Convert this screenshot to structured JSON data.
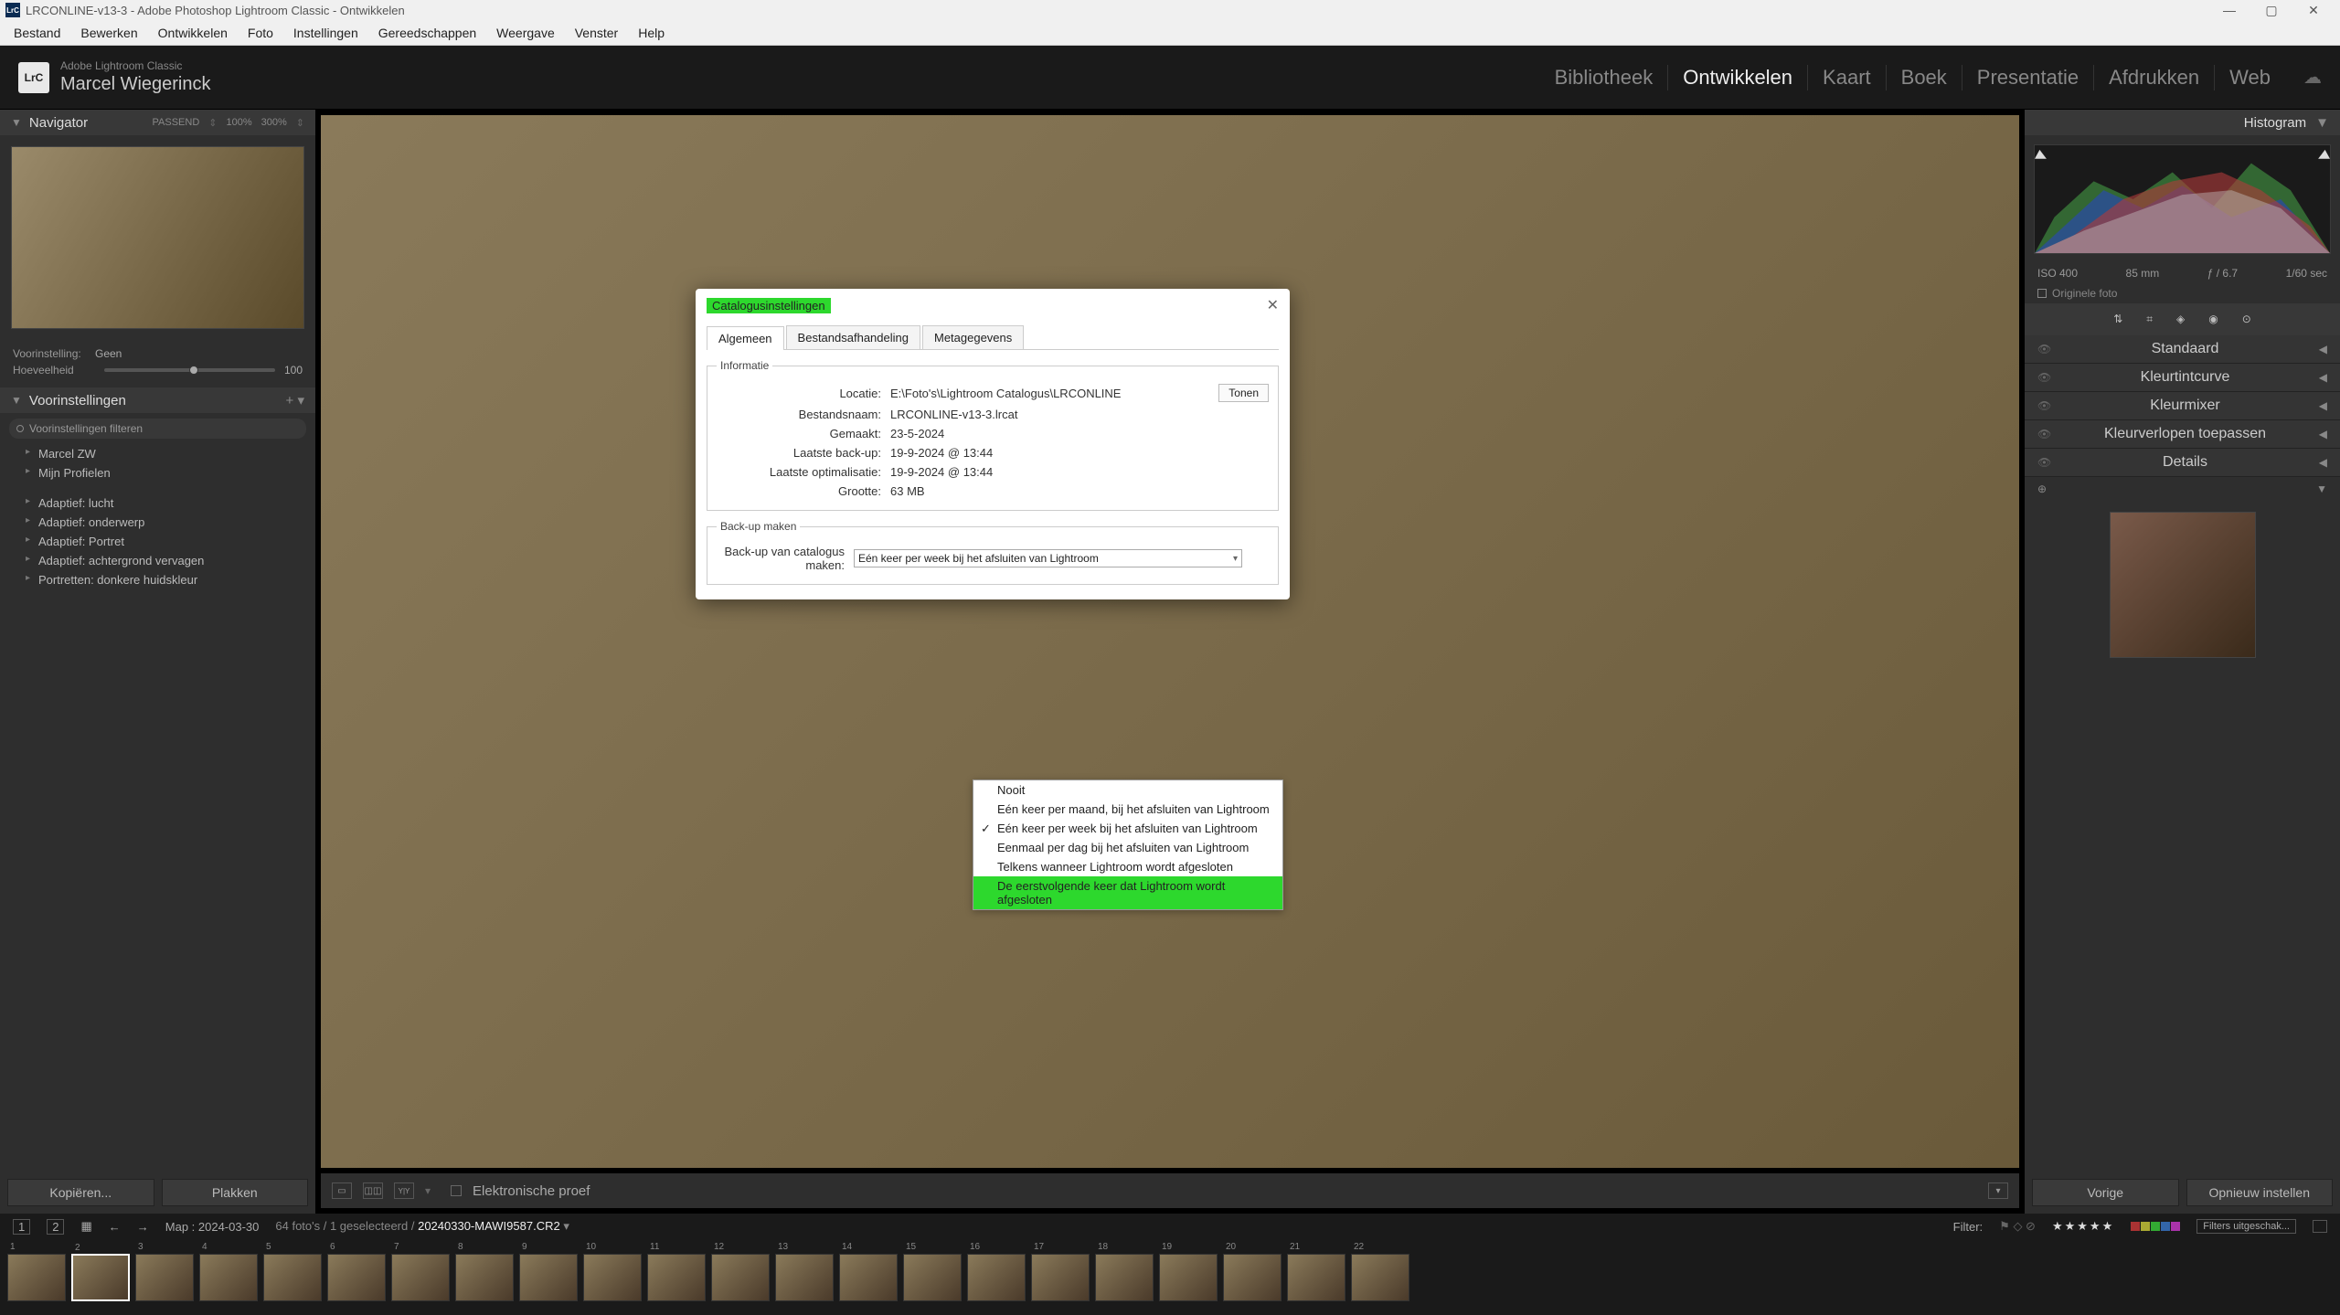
{
  "title_bar": "LRCONLINE-v13-3 - Adobe Photoshop Lightroom Classic - Ontwikkelen",
  "menu": [
    "Bestand",
    "Bewerken",
    "Ontwikkelen",
    "Foto",
    "Instellingen",
    "Gereedschappen",
    "Weergave",
    "Venster",
    "Help"
  ],
  "brand": {
    "icon": "LrC",
    "line1": "Adobe Lightroom Classic",
    "line2": "Marcel Wiegerinck"
  },
  "modules": [
    "Bibliotheek",
    "Ontwikkelen",
    "Kaart",
    "Boek",
    "Presentatie",
    "Afdrukken",
    "Web"
  ],
  "active_module": "Ontwikkelen",
  "navigator": {
    "title": "Navigator",
    "fit": "PASSEND",
    "zoom1": "100%",
    "zoom2": "300%"
  },
  "preset_ctrl": {
    "lbl1": "Voorinstelling:",
    "val1": "Geen",
    "lbl2": "Hoeveelheid",
    "val2": "100"
  },
  "presets_header": "Voorinstellingen",
  "filter_placeholder": "Voorinstellingen filteren",
  "preset_groups1": [
    "Marcel ZW",
    "Mijn Profielen"
  ],
  "preset_groups2": [
    "Adaptief: lucht",
    "Adaptief: onderwerp",
    "Adaptief: Portret",
    "Adaptief: achtergrond vervagen",
    "Portretten: donkere huidskleur"
  ],
  "buttons": {
    "copy": "Kopiëren...",
    "paste": "Plakken",
    "prev": "Vorige",
    "reset": "Opnieuw instellen"
  },
  "toolbar_label": "Elektronische proef",
  "histogram_title": "Histogram",
  "histo_meta": {
    "iso": "ISO 400",
    "focal": "85 mm",
    "fstop": "ƒ / 6.7",
    "shutter": "1/60 sec"
  },
  "histo_orig": "Originele foto",
  "right_sections": [
    "Standaard",
    "Kleurtintcurve",
    "Kleurmixer",
    "Kleurverlopen toepassen",
    "Details"
  ],
  "filmstrip": {
    "pages": [
      "1",
      "2"
    ],
    "path": "Map : 2024-03-30",
    "count": "64 foto's / 1 geselecteerd /",
    "file": "20240330-MAWI9587.CR2",
    "filter_lbl": "Filter:",
    "filters_off": "Filters uitgeschak..."
  },
  "dialog": {
    "title": "Catalogusinstellingen",
    "tabs": [
      "Algemeen",
      "Bestandsafhandeling",
      "Metagegevens"
    ],
    "section1": "Informatie",
    "rows": [
      {
        "lbl": "Locatie:",
        "val": "E:\\Foto's\\Lightroom Catalogus\\LRCONLINE"
      },
      {
        "lbl": "Bestandsnaam:",
        "val": "LRCONLINE-v13-3.lrcat"
      },
      {
        "lbl": "Gemaakt:",
        "val": "23-5-2024"
      },
      {
        "lbl": "Laatste back-up:",
        "val": "19-9-2024 @ 13:44"
      },
      {
        "lbl": "Laatste optimalisatie:",
        "val": "19-9-2024 @ 13:44"
      },
      {
        "lbl": "Grootte:",
        "val": "63 MB"
      }
    ],
    "tonen": "Tonen",
    "section2": "Back-up maken",
    "backup_lbl": "Back-up van catalogus maken:",
    "backup_selected": "Eén keer per week bij het afsluiten van Lightroom",
    "options": [
      "Nooit",
      "Eén keer per maand, bij het afsluiten van Lightroom",
      "Eén keer per week bij het afsluiten van Lightroom",
      "Eenmaal per dag bij het afsluiten van Lightroom",
      "Telkens wanneer Lightroom wordt afgesloten",
      "De eerstvolgende keer dat Lightroom wordt afgesloten"
    ],
    "checked_index": 2,
    "highlight_index": 5
  },
  "thumb_count": 22
}
